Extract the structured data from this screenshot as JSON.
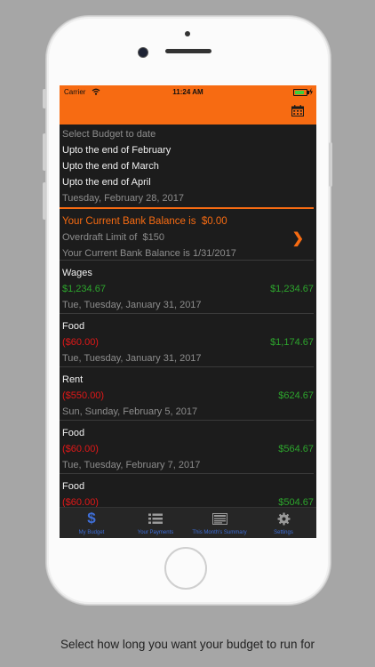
{
  "status_bar": {
    "carrier": "Carrier",
    "time": "11:24 AM"
  },
  "budget_options": {
    "heading": "Select Budget to date",
    "options": [
      "Upto the end of February",
      "Upto the end of March",
      "Upto the end of April"
    ],
    "selected_date": "Tuesday, February 28, 2017"
  },
  "balance": {
    "label": "Your Current Bank Balance is",
    "amount": "$0.00",
    "overdraft_label": "Overdraft Limit of",
    "overdraft_amount": "$150",
    "as_of": "Your Current Bank Balance is 1/31/2017"
  },
  "transactions": [
    {
      "name": "Wages",
      "amount": "$1,234.67",
      "amount_color": "green",
      "balance": "$1,234.67",
      "date": "Tue, Tuesday, January 31, 2017"
    },
    {
      "name": "Food",
      "amount": "($60.00)",
      "amount_color": "red",
      "balance": "$1,174.67",
      "date": "Tue, Tuesday, January 31, 2017"
    },
    {
      "name": "Rent",
      "amount": "($550.00)",
      "amount_color": "red",
      "balance": "$624.67",
      "date": "Sun, Sunday, February 5, 2017"
    },
    {
      "name": "Food",
      "amount": "($60.00)",
      "amount_color": "red",
      "balance": "$564.67",
      "date": "Tue, Tuesday, February 7, 2017"
    },
    {
      "name": "Food",
      "amount": "($60.00)",
      "amount_color": "red",
      "balance": "$504.67",
      "date": ""
    }
  ],
  "tabs": [
    {
      "label": "My Budget",
      "icon": "dollar-icon"
    },
    {
      "label": "Your Payments",
      "icon": "list-icon"
    },
    {
      "label": "This Month's Summary",
      "icon": "summary-icon"
    },
    {
      "label": "Settings",
      "icon": "gear-icon"
    }
  ],
  "caption": "Select how long you want your budget to run for",
  "colors": {
    "accent": "#f76b12",
    "positive": "#2da52d",
    "negative": "#e01818",
    "tab_tint": "#3f6fd8"
  }
}
